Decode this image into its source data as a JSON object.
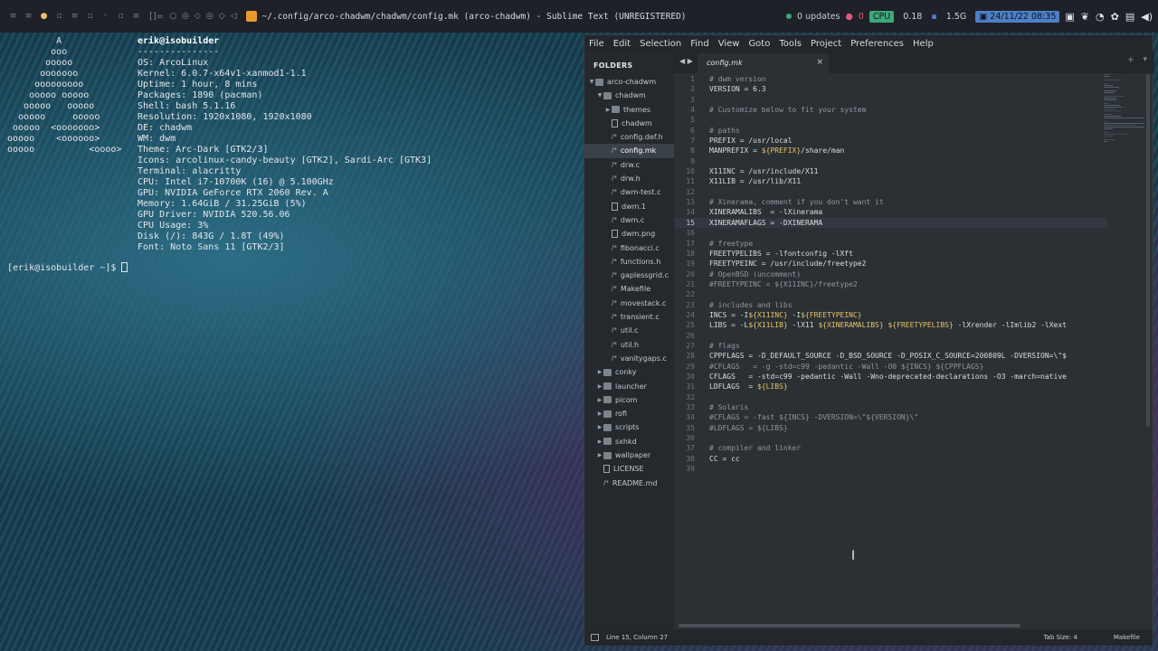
{
  "topbar": {
    "workspaces": [
      "≡",
      "≡",
      "●",
      "▫",
      "≡",
      "▫",
      "◦",
      "▫",
      "≡"
    ],
    "layout": "[]=",
    "extra_icons": [
      "○",
      "◎",
      "◇",
      "◎",
      "◇",
      "◁"
    ],
    "window_title": "~/.config/arco-chadwm/chadwm/config.mk (arco-chadwm) - Sublime Text (UNREGISTERED)",
    "updates": "0 updates",
    "updates_count": "0",
    "cpu_label": "CPU",
    "cpu_value": "0.18",
    "mem_value": "1.5G",
    "datetime": "24/11/22 08:35",
    "tray_icons": [
      "camera-icon",
      "wolf-icon",
      "wifi-icon",
      "gear-icon",
      "clipboard-icon",
      "volume-icon"
    ]
  },
  "terminal": {
    "ascii": "         A\n        ooo\n       ooooo\n      ooooooo\n     ooooooooo\n    ooooo ooooo\n   ooooo   ooooo\n  ooooo     ooooo\n ooooo  <ooooooo>\nooooo    <oooooo>\nooooo          <oooo>",
    "info_header": "erik@isobuilder",
    "separator": "---------------",
    "info": [
      "OS: ArcoLinux",
      "Kernel: 6.0.7-x64v1-xanmod1-1.1",
      "Uptime: 1 hour, 8 mins",
      "Packages: 1890 (pacman)",
      "Shell: bash 5.1.16",
      "Resolution: 1920x1080, 1920x1080",
      "DE: chadwm",
      "WM: dwm",
      "Theme: Arc-Dark [GTK2/3]",
      "Icons: arcolinux-candy-beauty [GTK2], Sardi-Arc [GTK3]",
      "Terminal: alacritty",
      "CPU: Intel i7-10700K (16) @ 5.100GHz",
      "GPU: NVIDIA GeForce RTX 2060 Rev. A",
      "Memory: 1.64GiB / 31.25GiB (5%)",
      "GPU Driver: NVIDIA 520.56.06",
      "CPU Usage: 3%",
      "Disk (/): 843G / 1.8T (49%)",
      "Font: Noto Sans 11 [GTK2/3]"
    ],
    "prompt": "[erik@isobuilder ~]$ "
  },
  "sublime": {
    "menu": [
      "File",
      "Edit",
      "Selection",
      "Find",
      "View",
      "Goto",
      "Tools",
      "Project",
      "Preferences",
      "Help"
    ],
    "folders_title": "FOLDERS",
    "tree": [
      {
        "label": "arco-chadwm",
        "kind": "folder",
        "depth": 0,
        "open": true
      },
      {
        "label": "chadwm",
        "kind": "folder",
        "depth": 1,
        "open": true
      },
      {
        "label": "themes",
        "kind": "folder",
        "depth": 2,
        "open": false
      },
      {
        "label": "chadwm",
        "kind": "file",
        "depth": 2
      },
      {
        "label": "config.def.h",
        "kind": "code",
        "depth": 2
      },
      {
        "label": "config.mk",
        "kind": "code",
        "depth": 2,
        "active": true
      },
      {
        "label": "drw.c",
        "kind": "code",
        "depth": 2
      },
      {
        "label": "drw.h",
        "kind": "code",
        "depth": 2
      },
      {
        "label": "dwm-test.c",
        "kind": "code",
        "depth": 2
      },
      {
        "label": "dwm.1",
        "kind": "file",
        "depth": 2
      },
      {
        "label": "dwm.c",
        "kind": "code",
        "depth": 2
      },
      {
        "label": "dwm.png",
        "kind": "file",
        "depth": 2
      },
      {
        "label": "fibonacci.c",
        "kind": "code",
        "depth": 2
      },
      {
        "label": "functions.h",
        "kind": "code",
        "depth": 2
      },
      {
        "label": "gaplessgrid.c",
        "kind": "code",
        "depth": 2
      },
      {
        "label": "Makefile",
        "kind": "code",
        "depth": 2
      },
      {
        "label": "movestack.c",
        "kind": "code",
        "depth": 2
      },
      {
        "label": "transient.c",
        "kind": "code",
        "depth": 2
      },
      {
        "label": "util.c",
        "kind": "code",
        "depth": 2
      },
      {
        "label": "util.h",
        "kind": "code",
        "depth": 2
      },
      {
        "label": "vanitygaps.c",
        "kind": "code",
        "depth": 2
      },
      {
        "label": "conky",
        "kind": "folder",
        "depth": 1,
        "open": false
      },
      {
        "label": "launcher",
        "kind": "folder",
        "depth": 1,
        "open": false
      },
      {
        "label": "picom",
        "kind": "folder",
        "depth": 1,
        "open": false
      },
      {
        "label": "rofi",
        "kind": "folder",
        "depth": 1,
        "open": false
      },
      {
        "label": "scripts",
        "kind": "folder",
        "depth": 1,
        "open": false
      },
      {
        "label": "sxhkd",
        "kind": "folder",
        "depth": 1,
        "open": false
      },
      {
        "label": "wallpaper",
        "kind": "folder",
        "depth": 1,
        "open": false
      },
      {
        "label": "LICENSE",
        "kind": "file",
        "depth": 1
      },
      {
        "label": "README.md",
        "kind": "code",
        "depth": 1
      }
    ],
    "tab_label": "config.mk",
    "current_line": 15,
    "code": [
      "# dwm version",
      "VERSION = 6.3",
      "",
      "# Customize below to fit your system",
      "",
      "# paths",
      "PREFIX = /usr/local",
      "MANPREFIX = ${PREFIX}/share/man",
      "",
      "X11INC = /usr/include/X11",
      "X11LIB = /usr/lib/X11",
      "",
      "# Xinerama, comment if you don't want it",
      "XINERAMALIBS  = -lXinerama",
      "XINERAMAFLAGS = -DXINERAMA",
      "",
      "# freetype",
      "FREETYPELIBS = -lfontconfig -lXft",
      "FREETYPEINC = /usr/include/freetype2",
      "# OpenBSD (uncomment)",
      "#FREETYPEINC = ${X11INC}/freetype2",
      "",
      "# includes and libs",
      "INCS = -I${X11INC} -I${FREETYPEINC}",
      "LIBS = -L${X11LIB} -lX11 ${XINERAMALIBS} ${FREETYPELIBS} -lXrender -lImlib2 -lXext",
      "",
      "# flags",
      "CPPFLAGS = -D_DEFAULT_SOURCE -D_BSD_SOURCE -D_POSIX_C_SOURCE=200809L -DVERSION=\\\"$",
      "#CFLAGS   = -g -std=c99 -pedantic -Wall -O0 ${INCS} ${CPPFLAGS}",
      "CFLAGS   = -std=c99 -pedantic -Wall -Wno-deprecated-declarations -O3 -march=native",
      "LDFLAGS  = ${LIBS}",
      "",
      "# Solaris",
      "#CFLAGS = -fast ${INCS} -DVERSION=\\\"${VERSION}\\\"",
      "#LDFLAGS = ${LIBS}",
      "",
      "# compiler and linker",
      "CC = cc",
      ""
    ],
    "status": {
      "position": "Line 15, Column 27",
      "tab_size": "Tab Size: 4",
      "syntax": "Makefile"
    }
  },
  "colors": {
    "accent_yellow": "#e8c266",
    "cpu_green": "#3ea87a",
    "date_blue": "#4e7fc6",
    "sublime_orange": "#e89a2c"
  }
}
